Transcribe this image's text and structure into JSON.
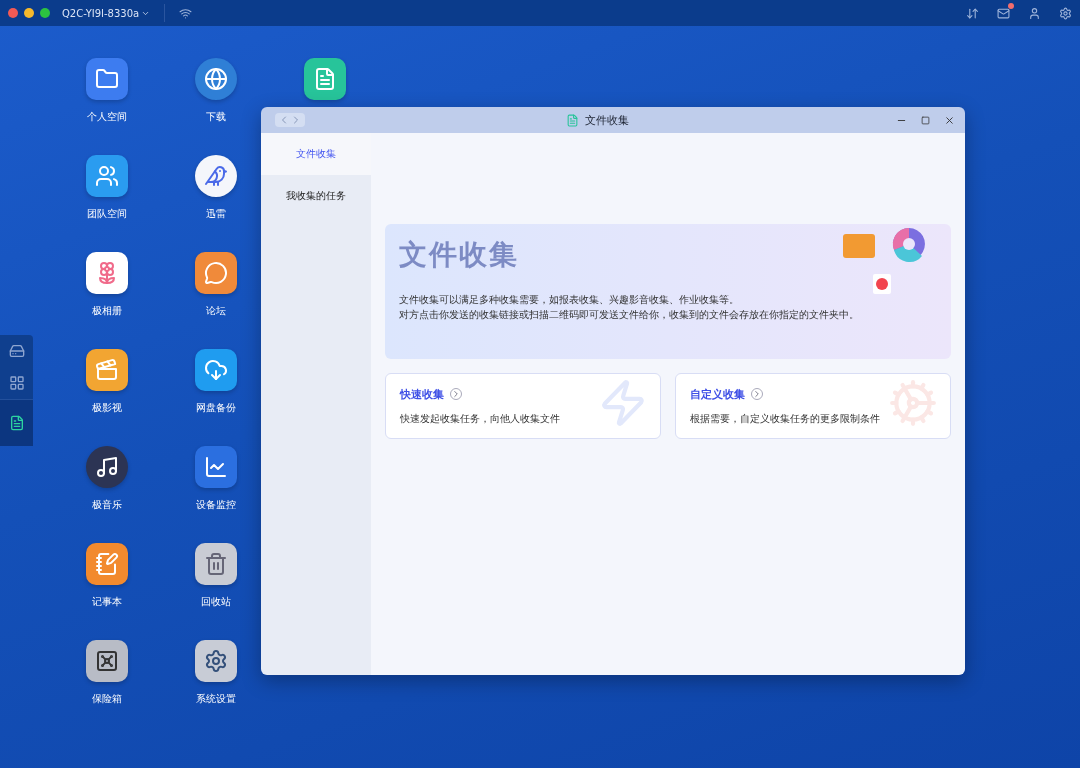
{
  "top_bar": {
    "device_name": "Q2C-YI9I-8330a",
    "mail_unread": true
  },
  "desktop_icons": [
    {
      "kind": "folder",
      "label": "个人空间"
    },
    {
      "kind": "download",
      "label": "下载"
    },
    {
      "kind": "filecollect"
    },
    {
      "kind": "team",
      "label": "团队空间"
    },
    {
      "kind": "thunder",
      "label": "迅雷"
    },
    {
      "kind": "blank"
    },
    {
      "kind": "photos",
      "label": "极相册"
    },
    {
      "kind": "forum",
      "label": "论坛"
    },
    {
      "kind": "blank"
    },
    {
      "kind": "video",
      "label": "极影视"
    },
    {
      "kind": "cloud",
      "label": "网盘备份"
    },
    {
      "kind": "blank"
    },
    {
      "kind": "music",
      "label": "极音乐"
    },
    {
      "kind": "monitor",
      "label": "设备监控"
    },
    {
      "kind": "blank"
    },
    {
      "kind": "notes",
      "label": "记事本"
    },
    {
      "kind": "trash",
      "label": "回收站"
    },
    {
      "kind": "blank"
    },
    {
      "kind": "safe",
      "label": "保险箱"
    },
    {
      "kind": "settings",
      "label": "系统设置"
    }
  ],
  "dock": [
    {
      "kind": "drive",
      "selected": false
    },
    {
      "kind": "apps",
      "selected": false
    },
    {
      "kind": "filecollect",
      "selected": true
    }
  ],
  "window": {
    "title": "文件收集",
    "sidebar": [
      {
        "label": "文件收集",
        "selected": true
      },
      {
        "label": "我收集的任务",
        "selected": false
      }
    ],
    "banner": {
      "title": "文件收集",
      "lines": [
        "文件收集可以满足多种收集需要，如报表收集、兴趣影音收集、作业收集等。",
        "对方点击你发送的收集链接或扫描二维码即可发送文件给你，收集到的文件会存放在你指定的文件夹中。"
      ]
    },
    "cards": [
      {
        "kind": "quick",
        "title": "快速收集",
        "description": "快速发起收集任务，向他人收集文件"
      },
      {
        "kind": "custom",
        "title": "自定义收集",
        "description": "根据需要，自定义收集任务的更多限制条件"
      }
    ]
  }
}
